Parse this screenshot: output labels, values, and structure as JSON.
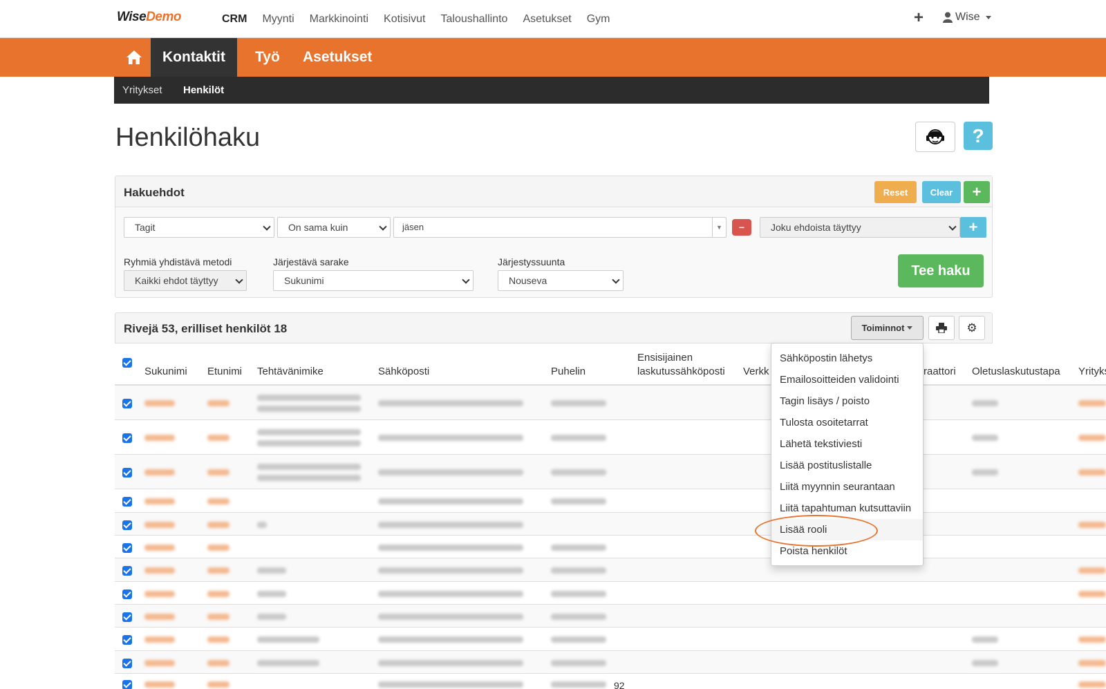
{
  "topnav": {
    "logo_a": "Wise",
    "logo_b": "Demo",
    "items": [
      "CRM",
      "Myynti",
      "Markkinointi",
      "Kotisivut",
      "Taloushallinto",
      "Asetukset",
      "Gym"
    ],
    "user": "Wise"
  },
  "mainnav": {
    "tabs": [
      "Kontaktit",
      "Työ",
      "Asetukset"
    ]
  },
  "subnav": {
    "items": [
      "Yritykset",
      "Henkilöt"
    ]
  },
  "page": {
    "title": "Henkilöhaku"
  },
  "search": {
    "title": "Hakuehdot",
    "reset": "Reset",
    "clear": "Clear",
    "field": "Tagit",
    "operator": "On sama kuin",
    "value": "jäsen",
    "condition": "Joku ehdoista täyttyy",
    "group_label": "Ryhmiä yhdistävä metodi",
    "group_value": "Kaikki ehdot täyttyy",
    "sort_label": "Järjestävä sarake",
    "sort_value": "Sukunimi",
    "dir_label": "Järjestyssuunta",
    "dir_value": "Nouseva",
    "submit": "Tee haku"
  },
  "results": {
    "summary": "Rivejä 53, erilliset henkilöt 18",
    "actions_label": "Toiminnot",
    "columns": [
      "Sukunimi",
      "Etunimi",
      "Tehtävänimike",
      "Sähköposti",
      "Puhelin",
      "Ensisijainen",
      "laskutussähköposti",
      "Verkk",
      "raattori",
      "Oletuslaskutustapa",
      "Yrityks"
    ],
    "fragment": "92"
  },
  "actions_menu": [
    "Sähköpostin lähetys",
    "Emailosoitteiden validointi",
    "Tagin lisäys / poisto",
    "Tulosta osoitetarrat",
    "Lähetä tekstiviesti",
    "Lisää postituslistalle",
    "Liitä myynnin seurantaan",
    "Liitä tapahtuman kutsuttaviin",
    "Lisää rooli",
    "Poista henkilöt"
  ],
  "colors": {
    "brand": "#e8732c",
    "dark": "#2c2c2c",
    "success": "#5cb85c",
    "info": "#5bc0de",
    "warning": "#f0ad4e",
    "danger": "#d9534f"
  }
}
